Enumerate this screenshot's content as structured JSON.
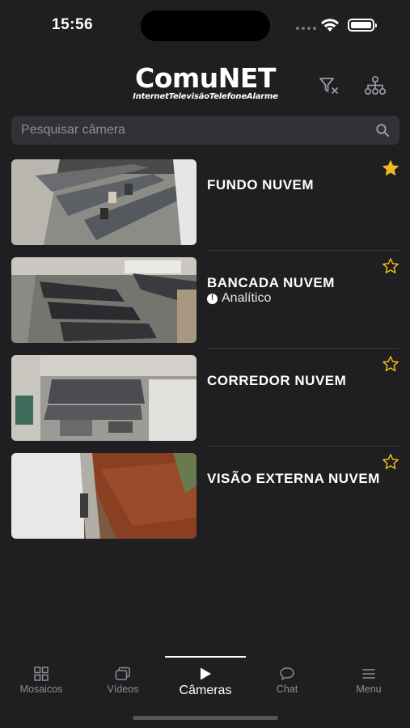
{
  "status": {
    "time": "15:56"
  },
  "header": {
    "logo_main": "ComuNET",
    "logo_sub": "InternetTelevisãoTelefoneAlarme",
    "filter_icon": "filter-clear-icon",
    "tree_icon": "hierarchy-icon"
  },
  "search": {
    "placeholder": "Pesquisar câmera",
    "value": ""
  },
  "cameras": [
    {
      "name": "FUNDO NUVEM",
      "tag": "",
      "favorite": true
    },
    {
      "name": "BANCADA NUVEM",
      "tag": "Analítico",
      "favorite": false
    },
    {
      "name": "CORREDOR NUVEM",
      "tag": "",
      "favorite": false
    },
    {
      "name": "VISÃO EXTERNA NUVEM",
      "tag": "",
      "favorite": false
    }
  ],
  "tabs": [
    {
      "label": "Mosaicos",
      "icon": "grid-icon"
    },
    {
      "label": "Vídeos",
      "icon": "videos-icon"
    },
    {
      "label": "Câmeras",
      "icon": "play-icon",
      "active": true
    },
    {
      "label": "Chat",
      "icon": "chat-icon"
    },
    {
      "label": "Menu",
      "icon": "menu-icon"
    }
  ],
  "colors": {
    "background": "#1f1f22",
    "search_bg": "#323236",
    "star_gold": "#f2b91c",
    "inactive_tab": "#8e8e93"
  }
}
